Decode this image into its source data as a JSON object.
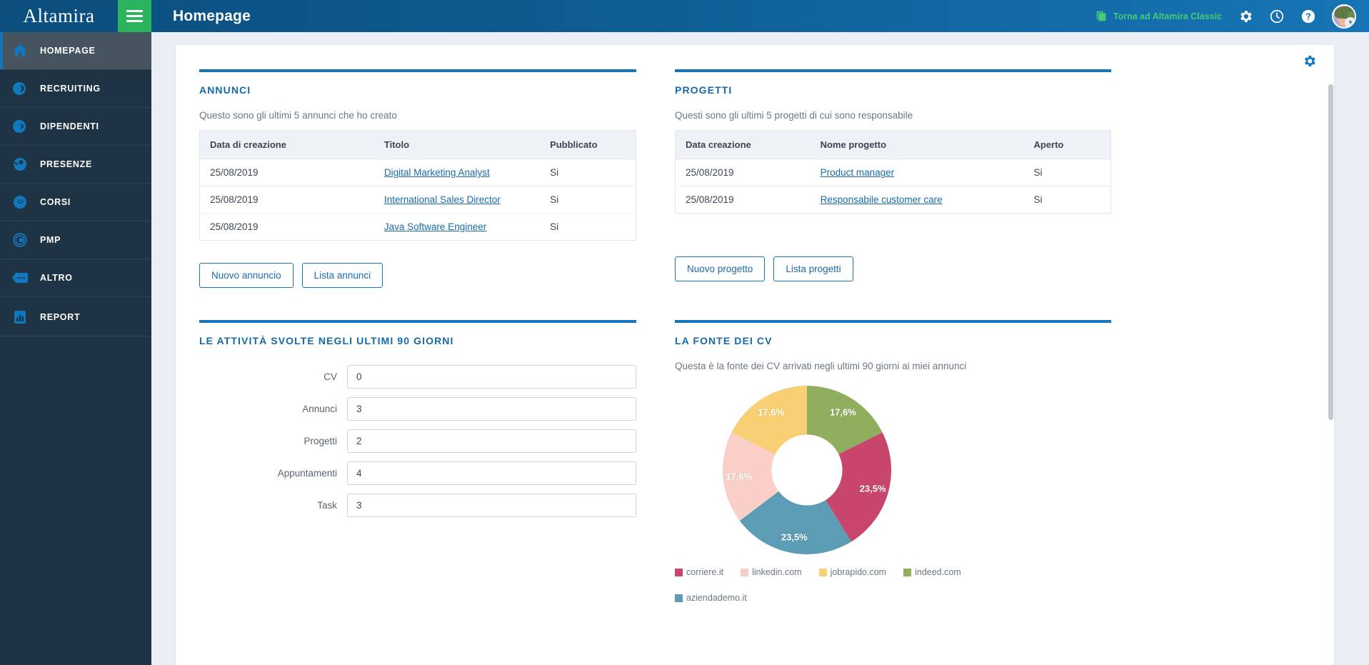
{
  "topbar": {
    "brand": "Altamira",
    "page_title": "Homepage",
    "classic_link": "Torna ad Altamira Classic",
    "icons": [
      "copy-icon",
      "gear-icon",
      "clock-icon",
      "help-icon",
      "avatar"
    ],
    "accent_green": "#2cb35e",
    "accent_blue": "#0b4f7e"
  },
  "sidebar": {
    "items": [
      {
        "label": "HOMEPAGE",
        "icon": "home-icon",
        "active": true
      },
      {
        "label": "RECRUITING",
        "icon": "recruiting-icon",
        "active": false
      },
      {
        "label": "DIPENDENTI",
        "icon": "employees-icon",
        "active": false
      },
      {
        "label": "PRESENZE",
        "icon": "attendance-icon",
        "active": false
      },
      {
        "label": "CORSI",
        "icon": "courses-icon",
        "active": false
      },
      {
        "label": "PMP",
        "icon": "pmp-icon",
        "active": false
      },
      {
        "label": "ALTRO",
        "icon": "more-icon",
        "active": false
      },
      {
        "label": "REPORT",
        "icon": "report-icon",
        "active": false
      }
    ]
  },
  "card": {
    "gear_icon": "gear-icon"
  },
  "annunci": {
    "title": "ANNUNCI",
    "subtitle": "Questo sono gli ultimi 5 annunci che ho creato",
    "columns": [
      "Data di creazione",
      "Titolo",
      "Pubblicato"
    ],
    "rows": [
      {
        "date": "25/08/2019",
        "title": "Digital Marketing Analyst",
        "published": "Si"
      },
      {
        "date": "25/08/2019",
        "title": "International Sales Director",
        "published": "Si"
      },
      {
        "date": "25/08/2019",
        "title": "Java Software Engineer",
        "published": "Si"
      }
    ],
    "buttons": {
      "new": "Nuovo annuncio",
      "list": "Lista annunci"
    }
  },
  "progetti": {
    "title": "PROGETTI",
    "subtitle": "Questi sono gli ultimi 5 progetti di cui sono responsabile",
    "columns": [
      "Data creazione",
      "Nome progetto",
      "Aperto"
    ],
    "rows": [
      {
        "date": "25/08/2019",
        "name": "Product manager",
        "open": "Si"
      },
      {
        "date": "25/08/2019",
        "name": "Responsabile customer care",
        "open": "Si"
      }
    ],
    "buttons": {
      "new": "Nuovo progetto",
      "list": "Lista progetti"
    }
  },
  "attivita": {
    "title": "LE ATTIVITÀ SVOLTE NEGLI ULTIMI 90 GIORNI",
    "fields": [
      {
        "label": "CV",
        "value": "0"
      },
      {
        "label": "Annunci",
        "value": "3"
      },
      {
        "label": "Progetti",
        "value": "2"
      },
      {
        "label": "Appuntamenti",
        "value": "4"
      },
      {
        "label": "Task",
        "value": "3"
      }
    ]
  },
  "fonte_cv": {
    "title": "LA FONTE DEI CV",
    "subtitle": "Questa è la fonte dei CV arrivati negli ultimi 90 giorni ai miei annunci"
  },
  "chart_data": {
    "type": "pie",
    "title": "LA FONTE DEI CV",
    "subtitle": "Questa è la fonte dei CV arrivati negli ultimi 90 giorni ai miei annunci",
    "donut": true,
    "inner_radius_ratio": 0.42,
    "categories": [
      "corriere.it",
      "linkedin.com",
      "jobrapido.com",
      "indeed.com",
      "aziendademo.it"
    ],
    "values": [
      23.5,
      17.6,
      17.6,
      17.6,
      23.5
    ],
    "value_labels": [
      "23,5%",
      "17,6%",
      "17,6%",
      "17,6%",
      "23,5%"
    ],
    "colors": [
      "#c8456c",
      "#f9cfc8",
      "#f8cf72",
      "#8faf5f",
      "#5c9cb5"
    ],
    "legend_position": "bottom",
    "slice_order_from_top_clockwise": [
      "indeed.com",
      "corriere.it",
      "aziendademo.it",
      "linkedin.com",
      "jobrapido.com"
    ]
  }
}
